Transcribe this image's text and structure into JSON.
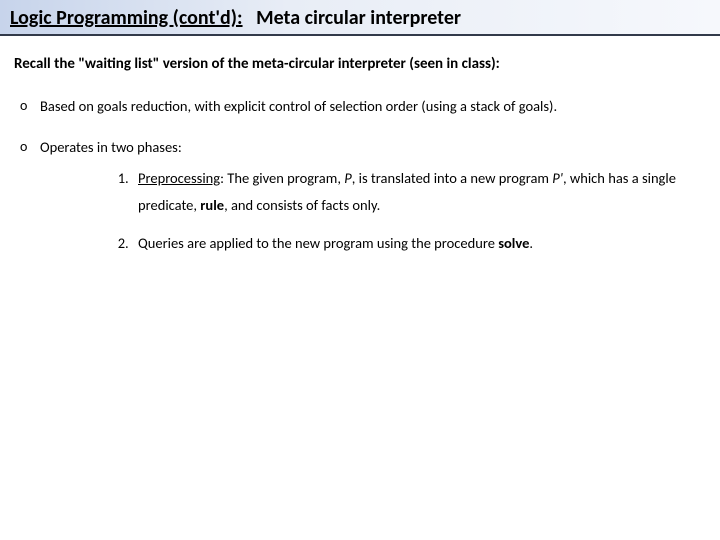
{
  "header": {
    "topic": "Logic Programming (cont'd):",
    "subtitle": "Meta circular interpreter"
  },
  "intro": "Recall the \"waiting list\" version of the meta-circular interpreter (seen in class):",
  "bullets": {
    "b1": "Based on goals reduction, with explicit control of selection order (using a stack of goals).",
    "b2": "Operates in two phases:"
  },
  "phases": {
    "p1_label": "Preprocessing",
    "p1_a": ": The given program, ",
    "p1_P": "P",
    "p1_b": ", is translated into a  new program ",
    "p1_P2": "P'",
    "p1_c": ", which has a single predicate, ",
    "p1_rule": "rule",
    "p1_d": ", and consists of facts only.",
    "p2_a": "Queries are applied to the new program using the procedure ",
    "p2_solve": "solve",
    "p2_b": "."
  }
}
